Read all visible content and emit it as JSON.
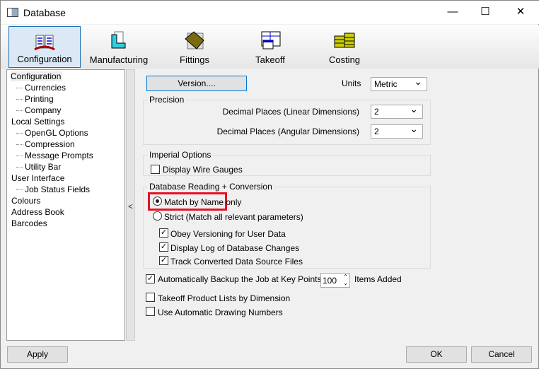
{
  "window": {
    "title": "Database",
    "minimize": "—",
    "maximize": "☐",
    "close": "✕"
  },
  "tabs": [
    {
      "label": "Configuration"
    },
    {
      "label": "Manufacturing"
    },
    {
      "label": "Fittings"
    },
    {
      "label": "Takeoff"
    },
    {
      "label": "Costing"
    }
  ],
  "tree": [
    "Configuration",
    "Currencies",
    "Printing",
    "Company",
    "Local Settings",
    "OpenGL Options",
    "Compression",
    "Message Prompts",
    "Utility Bar",
    "User Interface",
    "Job Status Fields",
    "Colours",
    "Address Book",
    "Barcodes"
  ],
  "splitter": "<",
  "form": {
    "version_button": "Version....",
    "units_label": "Units",
    "units_value": "Metric",
    "precision": {
      "title": "Precision",
      "linear_label": "Decimal Places (Linear Dimensions)",
      "linear_value": "2",
      "angular_label": "Decimal Places (Angular Dimensions)",
      "angular_value": "2"
    },
    "imperial": {
      "title": "Imperial Options",
      "wire_gauges": "Display Wire Gauges"
    },
    "db": {
      "title": "Database Reading + Conversion",
      "match_name": "Match by Name only",
      "strict": "Strict (Match all relevant parameters)",
      "obey": "Obey Versioning for User Data",
      "log": "Display Log of Database Changes",
      "track": "Track Converted Data Source Files"
    },
    "backup_label": "Automatically Backup the Job at Key Points +",
    "backup_value": "100",
    "items_added": "Items Added",
    "takeoff_lists": "Takeoff Product Lists by Dimension",
    "auto_numbers": "Use Automatic Drawing Numbers"
  },
  "buttons": {
    "apply": "Apply",
    "ok": "OK",
    "cancel": "Cancel"
  },
  "colors": {
    "highlight": "#e81123",
    "accent": "#0078d7"
  }
}
